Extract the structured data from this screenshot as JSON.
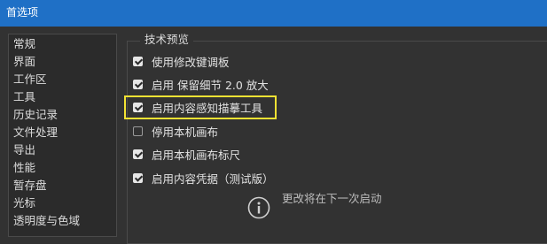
{
  "window": {
    "title": "首选项"
  },
  "sidebar": {
    "items": [
      {
        "label": "常规"
      },
      {
        "label": "界面"
      },
      {
        "label": "工作区"
      },
      {
        "label": "工具"
      },
      {
        "label": "历史记录"
      },
      {
        "label": "文件处理"
      },
      {
        "label": "导出"
      },
      {
        "label": "性能"
      },
      {
        "label": "暂存盘"
      },
      {
        "label": "光标"
      },
      {
        "label": "透明度与色域"
      }
    ]
  },
  "group": {
    "title": "技术预览",
    "options": [
      {
        "label": "使用修改键调板",
        "checked": true
      },
      {
        "label": "启用 保留细节 2.0 放大",
        "checked": true
      },
      {
        "label": "启用内容感知描摹工具",
        "checked": true,
        "highlighted": true
      },
      {
        "label": "停用本机画布",
        "checked": false
      },
      {
        "label": "启用本机画布标尺",
        "checked": true
      },
      {
        "label": "启用内容凭据（测试版）",
        "checked": true
      }
    ],
    "info": {
      "icon": "info-icon",
      "text": "更改将在下一次启动"
    }
  },
  "colors": {
    "titlebar": "#1f70c6",
    "background": "#323232",
    "highlight_border": "#f3e233"
  }
}
